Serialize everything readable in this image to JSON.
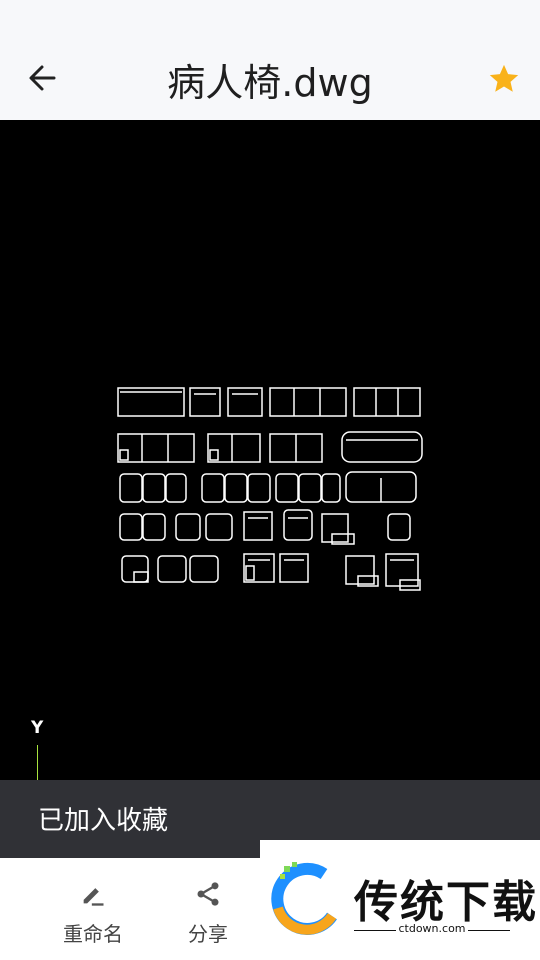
{
  "header": {
    "title": "病人椅.dwg"
  },
  "axis": {
    "y_label": "Y"
  },
  "toast": {
    "message": "已加入收藏"
  },
  "toolbar": {
    "rename_label": "重命名",
    "share_label": "分享"
  },
  "ad": {
    "brand": "传统下载",
    "url": "ctdown.com"
  },
  "colors": {
    "star": "#f9b21a",
    "axis": "#a8e33e",
    "toast_bg": "#303136"
  }
}
